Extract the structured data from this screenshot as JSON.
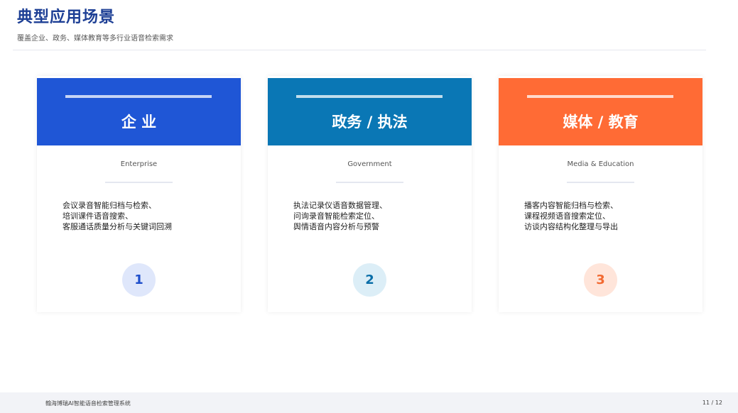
{
  "header": {
    "title": "典型应用场景",
    "subtitle": "覆盖企业、政务、媒体教育等多行业语音检索需求"
  },
  "cards": [
    {
      "title": "企 业",
      "subtitle_en": "Enterprise",
      "lines": [
        "会议录音智能归档与检索、",
        "培训课件语音搜索、",
        "客服通话质量分析与关键词回溯"
      ],
      "number": "1",
      "color": "#1f56d6",
      "num_bg": "#dfe7fb",
      "num_color": "#1f4fcb"
    },
    {
      "title": "政务 / 执法",
      "subtitle_en": "Government",
      "lines": [
        "执法记录仪语音数据管理、",
        "问询录音智能检索定位、",
        "舆情语音内容分析与预警"
      ],
      "number": "2",
      "color": "#0a77b5",
      "num_bg": "#dceef7",
      "num_color": "#0a6ea8"
    },
    {
      "title": "媒体 / 教育",
      "subtitle_en": "Media & Education",
      "lines": [
        "播客内容智能归档与检索、",
        "课程视频语音搜索定位、",
        "访谈内容结构化整理与导出"
      ],
      "number": "3",
      "color": "#ff6b35",
      "num_bg": "#ffe5da",
      "num_color": "#f26a32"
    }
  ],
  "footer": {
    "left": "翰海博瑞AI智能语音检索管理系统",
    "page": "11 / 12"
  }
}
